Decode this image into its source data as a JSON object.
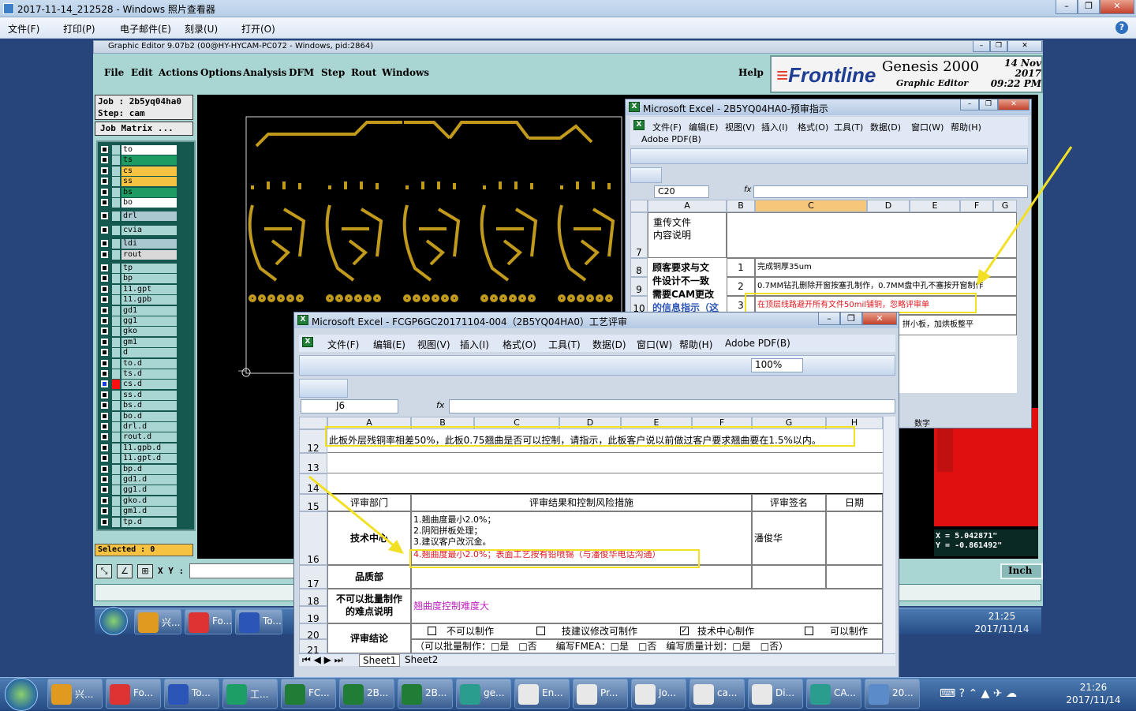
{
  "viewer": {
    "title": "2017-11-14_212528 - Windows 照片查看器",
    "menu": [
      "文件(F)",
      "打印(P)",
      "电子邮件(E)",
      "刻录(U)",
      "打开(O)"
    ],
    "help": "?"
  },
  "genesis": {
    "title": "Graphic Editor 9.07b2 (00@HY-HYCAM-PC072 - Windows, pid:2864)",
    "menu": [
      "File",
      "Edit",
      "Actions",
      "Options",
      "Analysis",
      "DFM",
      "Step",
      "Rout",
      "Windows"
    ],
    "help": "Help",
    "brand": {
      "logo_a": "Frontline",
      "app": "Genesis 2000",
      "sub": "Graphic Editor",
      "date": "14 Nov 2017",
      "time": "09:22 PM"
    },
    "job_line": "Job : 2b5yq04ha0",
    "step_line": "Step: cam",
    "matrix_button": "Job Matrix ...",
    "layers": [
      "to",
      "ts",
      "cs",
      "ss",
      "bs",
      "bo",
      "drl",
      "cvia",
      "ldi",
      "rout",
      "tp",
      "bp",
      "11.gpt",
      "11.gpb",
      "gd1",
      "gg1",
      "gko",
      "gm1",
      "d",
      "to.d",
      "ts.d",
      "cs.d",
      "ss.d",
      "bs.d",
      "bo.d",
      "drl.d",
      "rout.d",
      "11.gpb.d",
      "11.gpt.d",
      "bp.d",
      "gd1.d",
      "gg1.d",
      "gko.d",
      "gm1.d",
      "tp.d"
    ],
    "selected": "Selected : 0",
    "xy_label": "X Y :",
    "unit": "Inch",
    "coords": {
      "x": "X = 5.042871\"",
      "y": "Y = -0.861492\""
    }
  },
  "excel1": {
    "title": "Microsoft Excel - 2B5YQ04HA0-预审指示",
    "menu": [
      "文件(F)",
      "编辑(E)",
      "视图(V)",
      "插入(I)",
      "格式(O)",
      "工具(T)",
      "数据(D)",
      "窗口(W)",
      "帮助(H)"
    ],
    "menu2": "Adobe PDF(B)",
    "name_box": "C20",
    "fx": "fx",
    "cols": [
      "A",
      "B",
      "C",
      "D",
      "E",
      "F",
      "G"
    ],
    "rows": [
      {
        "n": "7",
        "a": "重传文件\n内容说明",
        "b": "",
        "c": ""
      },
      {
        "n": "8",
        "a": "顾客要求与文",
        "b": "1",
        "c": "完成铜厚35um"
      },
      {
        "n": "9",
        "a": "件设计不一致",
        "b": "2",
        "c": "0.7MM钻孔删除开窗按塞孔制作，0.7MM盘中孔不塞按开窗制作"
      },
      {
        "n": "10",
        "a": "需要CAM更改",
        "b": "3",
        "c": "在顶层线路避开所有文件50mil铺铜，忽略评审单"
      },
      {
        "n": "",
        "a": "的信息指示（这",
        "b": "",
        "c": ""
      }
    ],
    "right_text": "拼小板，加烘板整平",
    "status": "数字"
  },
  "excel2": {
    "title": "Microsoft Excel - FCGP6GC20171104-004（2B5YQ04HA0）工艺评审",
    "menu": [
      "文件(F)",
      "编辑(E)",
      "视图(V)",
      "插入(I)",
      "格式(O)",
      "工具(T)",
      "数据(D)",
      "窗口(W)",
      "帮助(H)",
      "Adobe PDF(B)"
    ],
    "zoom": "100%",
    "name_box": "J6",
    "fx": "fx",
    "cols": [
      "A",
      "B",
      "C",
      "D",
      "E",
      "F",
      "G",
      "H"
    ],
    "row12": "此板外层残铜率相差50%，此板0.75翘曲是否可以控制，请指示，此板客户说以前做过客户要求翘曲要在1.5%以内。",
    "header": {
      "dept": "评审部门",
      "result": "评审结果和控制风险措施",
      "sign": "评审签名",
      "date": "日期"
    },
    "tech_dept": "技术中心",
    "tech_lines": [
      "1.翘曲度最小2.0%；",
      "2.阴阳拼板处理；",
      "3.建议客户改沉金。",
      "4.翘曲度最小2.0%；表面工艺按有铅喷锡（与潘俊华电话沟通）"
    ],
    "tech_sign": "潘俊华",
    "quality": "品质部",
    "difficulty_label": "不可以批量制作\n的难点说明",
    "difficulty": "翘曲度控制难度大",
    "conclusion": "评审结论",
    "conc_opts": [
      "不可以制作",
      "技建议修改可制作",
      "技术中心制作",
      "可以制作"
    ],
    "row21": "（可以批量制作：□是　□否　　编写FMEA：□是　□否　编写质量计划：□是　□否）",
    "sheets": [
      "Sheet1",
      "Sheet2"
    ],
    "row_nums": [
      "12",
      "13",
      "14",
      "15",
      "16",
      "17",
      "18",
      "19",
      "20",
      "21"
    ]
  },
  "taskbar_inner": {
    "items": [
      "兴...",
      "Fo...",
      "To..."
    ],
    "time": "21:25",
    "date": "2017/11/14"
  },
  "taskbar": {
    "items": [
      "兴...",
      "Fo...",
      "To...",
      "工...",
      "FC...",
      "2B...",
      "2B...",
      "ge...",
      "En...",
      "Pr...",
      "Jo...",
      "ca...",
      "Di...",
      "CA...",
      "20..."
    ],
    "time": "21:26",
    "date": "2017/11/14"
  },
  "colors": {
    "genesis_bg": "#a9d5d3",
    "highlight": "#f2e024",
    "red_text": "#e0161b",
    "trace": "#c19a1c"
  }
}
